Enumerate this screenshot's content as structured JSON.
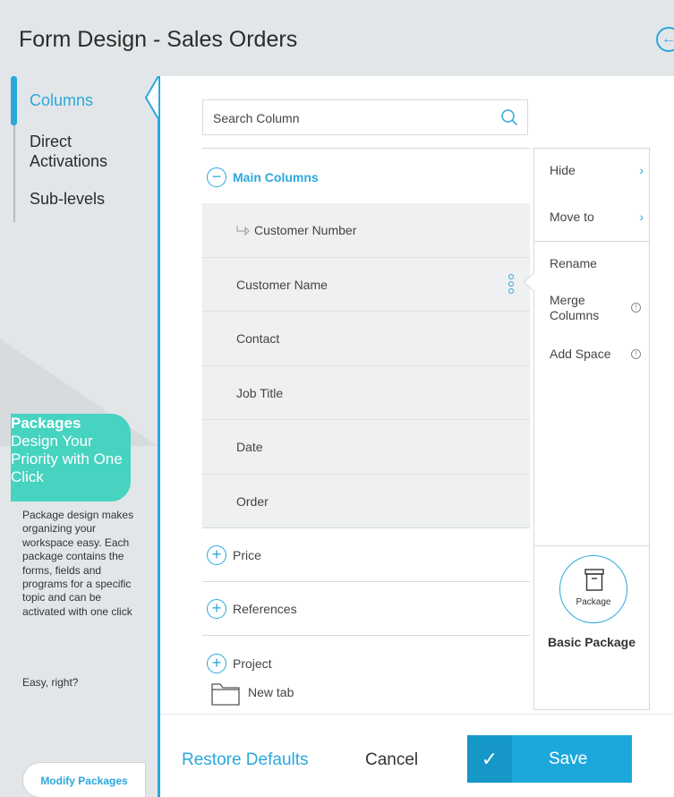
{
  "header": {
    "title": "Form Design - Sales Orders",
    "back_icon": "arrow-left-circle-icon"
  },
  "nav": {
    "items": [
      {
        "label": "Columns",
        "active": true
      },
      {
        "label": "Direct Activations",
        "active": false
      },
      {
        "label": "Sub-levels",
        "active": false
      }
    ]
  },
  "promo": {
    "heading": "Packages",
    "tagline": "Design Your Priority with One Click",
    "description": "Package design makes organizing your workspace easy. Each package contains the forms, fields and programs for a specific topic and can be activated with one click",
    "closing": "Easy, right?",
    "button_label": "Modify Packages"
  },
  "search": {
    "placeholder": "Search Column"
  },
  "columns": {
    "main_group_label": "Main Columns",
    "rows": [
      {
        "label": "Customer Number",
        "has_link_icon": true
      },
      {
        "label": "Customer Name",
        "selected": true
      },
      {
        "label": "Contact"
      },
      {
        "label": "Job Title"
      },
      {
        "label": "Date"
      },
      {
        "label": "Order"
      }
    ],
    "sections": [
      "Price",
      "References",
      "Project"
    ],
    "new_tab_label": "New tab"
  },
  "context_menu": {
    "items": [
      {
        "label": "Hide",
        "chevron": true
      },
      {
        "label": "Move to",
        "chevron": true
      },
      {
        "label": "Rename"
      },
      {
        "label": "Merge Columns",
        "info": true
      },
      {
        "label": "Add Space",
        "info": true
      }
    ],
    "package_icon_label": "Package",
    "package_name": "Basic Package"
  },
  "footer": {
    "restore_label": "Restore Defaults",
    "cancel_label": "Cancel",
    "save_label": "Save"
  },
  "colors": {
    "accent": "#2aa8dc",
    "promo": "#46d3c0",
    "save": "#1da8dc"
  }
}
